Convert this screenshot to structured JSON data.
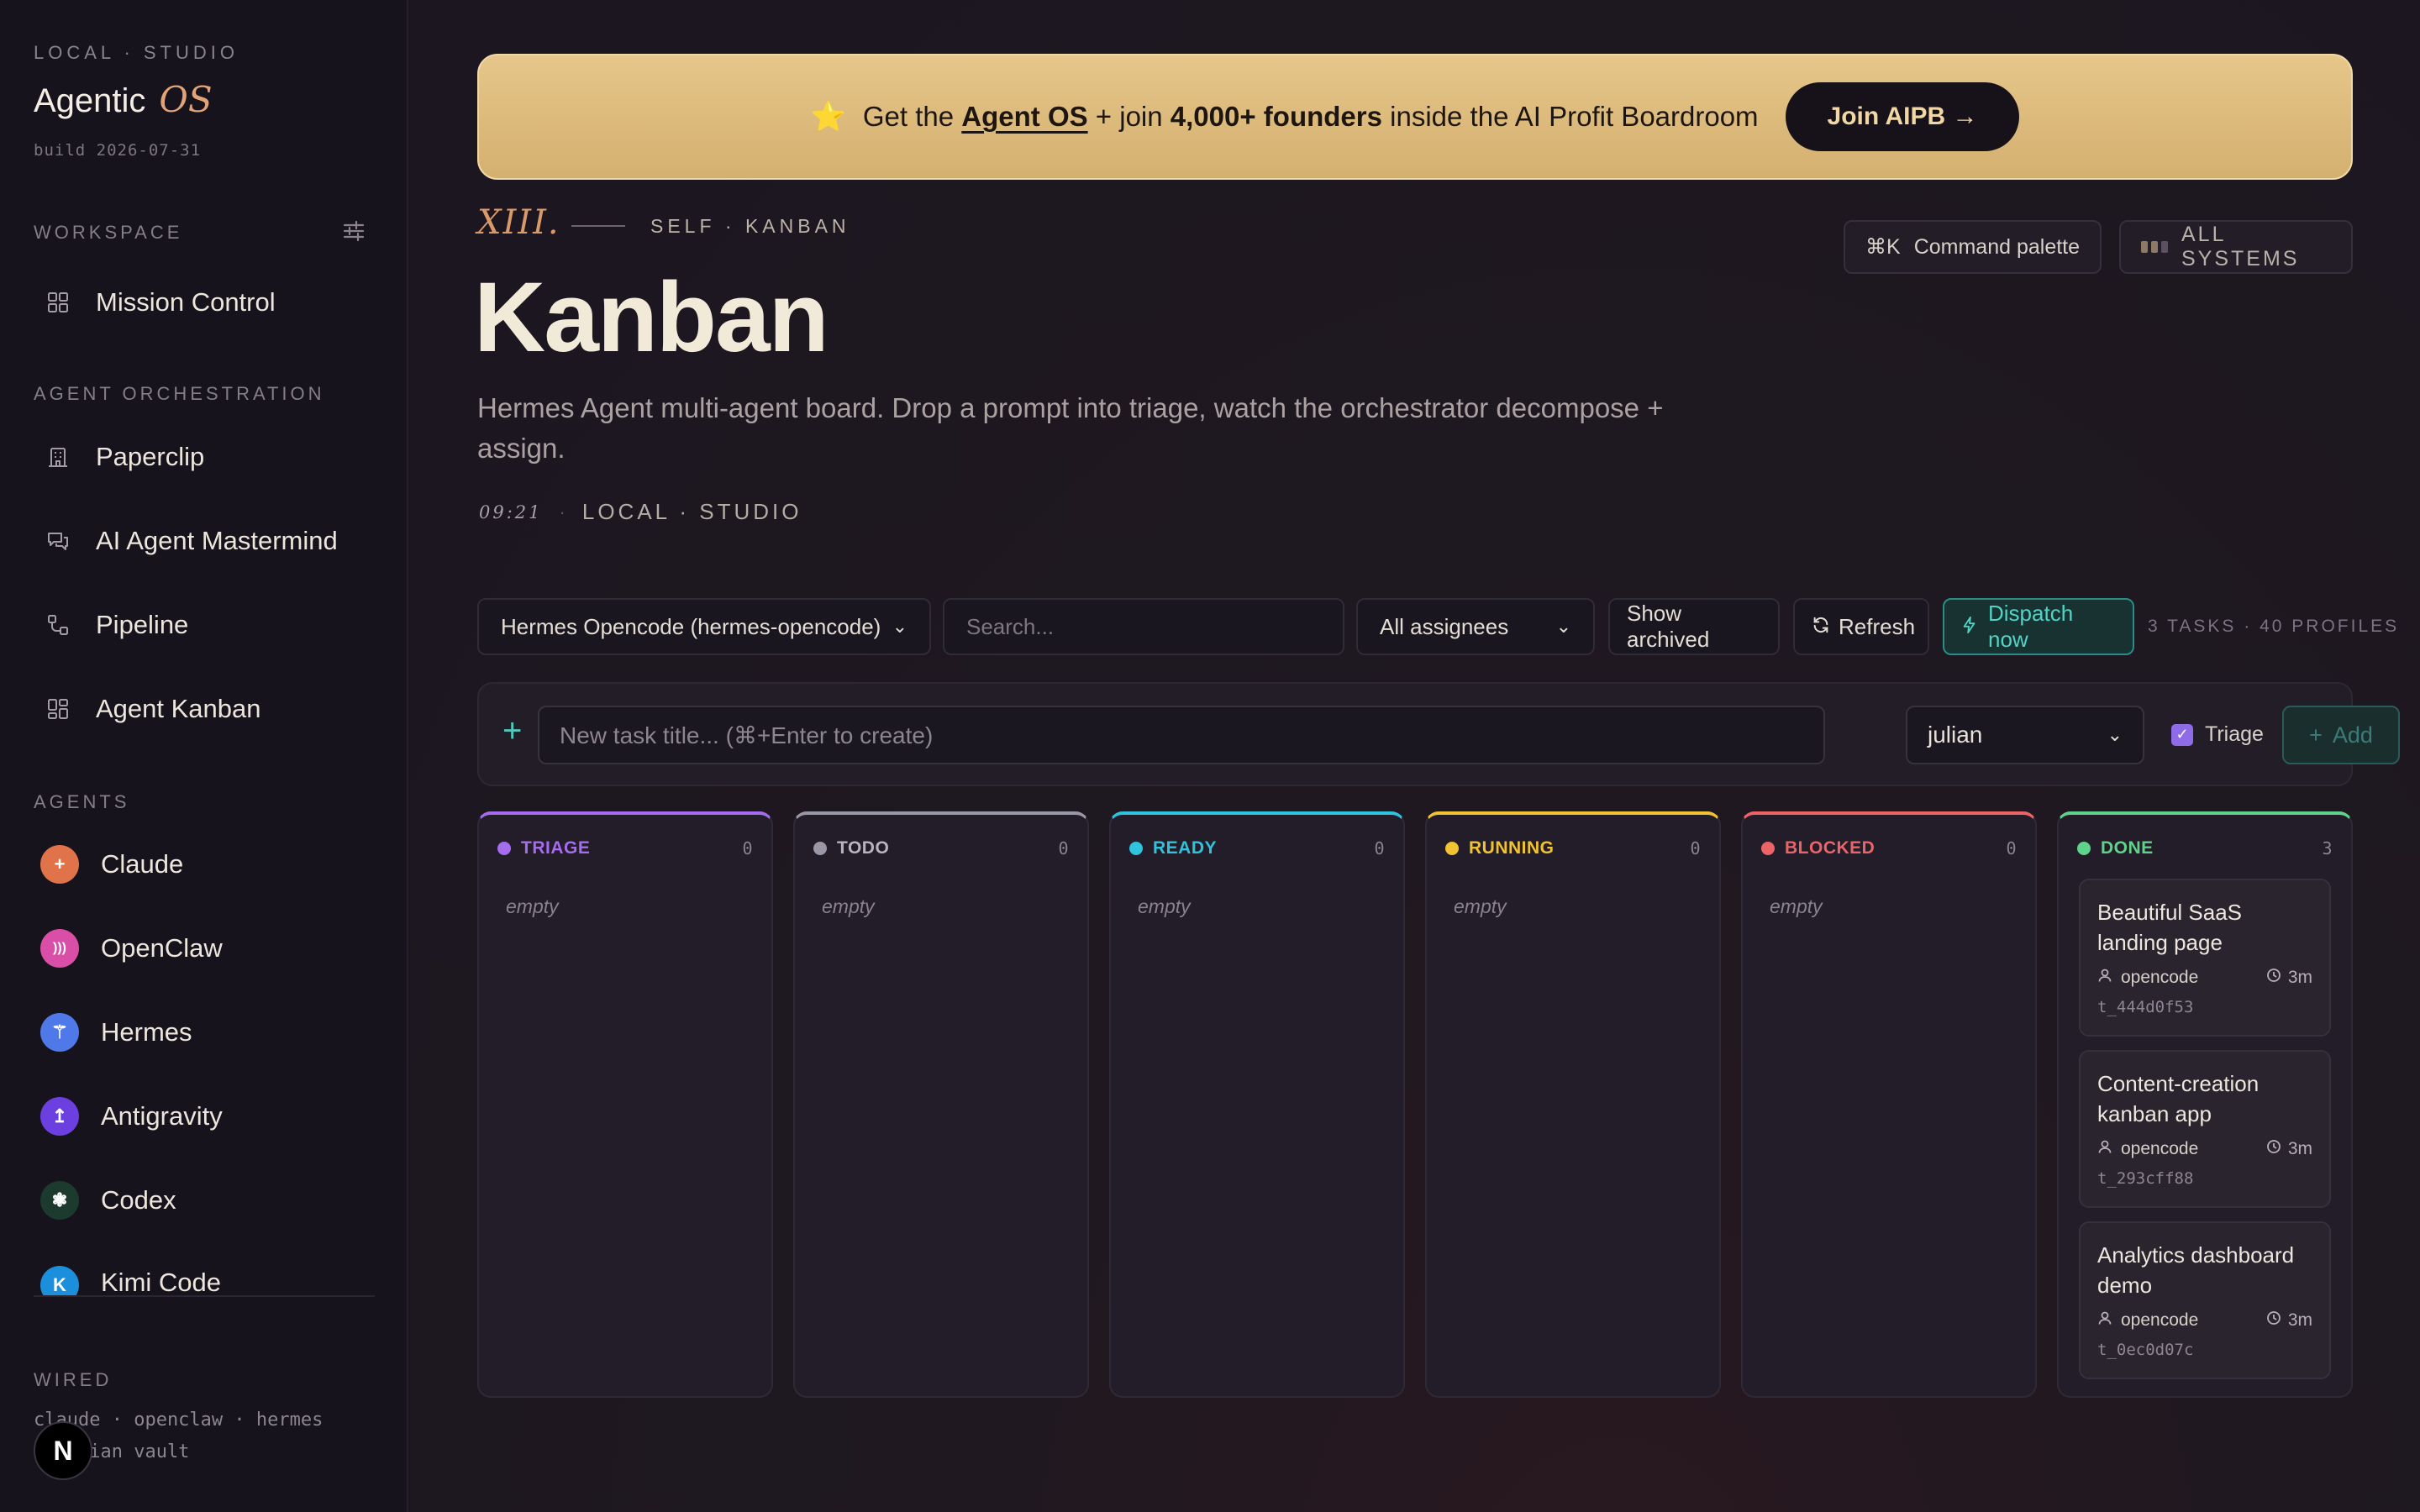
{
  "sidebar": {
    "eyebrow": "LOCAL · STUDIO",
    "brand": "Agentic",
    "brand_accent": "OS",
    "build": "build 2026-07-31",
    "workspace_label": "WORKSPACE",
    "workspace_items": [
      {
        "label": "Mission Control",
        "icon": "grid-icon"
      }
    ],
    "orchestration_label": "AGENT ORCHESTRATION",
    "orchestration_items": [
      {
        "label": "Paperclip",
        "icon": "building-icon"
      },
      {
        "label": "AI Agent Mastermind",
        "icon": "chat-icon"
      },
      {
        "label": "Pipeline",
        "icon": "pipeline-icon"
      },
      {
        "label": "Agent Kanban",
        "icon": "grid-icon"
      }
    ],
    "agents_label": "AGENTS",
    "agents": [
      {
        "label": "Claude",
        "glyph": "+",
        "color": "#e0734a"
      },
      {
        "label": "OpenClaw",
        "glyph": ")))",
        "color": "#d94fa7"
      },
      {
        "label": "Hermes",
        "glyph": "⚚",
        "color": "#4f78e8"
      },
      {
        "label": "Antigravity",
        "glyph": "↥",
        "color": "#6b3fe0"
      },
      {
        "label": "Codex",
        "glyph": "❃",
        "color": "#1c3a2e"
      },
      {
        "label": "Kimi Code",
        "glyph": "K",
        "color": "#1b8fdc"
      }
    ],
    "wired_label": "WIRED",
    "wired_line1": "claude · openclaw · hermes",
    "wired_line2": "obsidian vault",
    "n_badge": "N"
  },
  "banner": {
    "star": "⭐",
    "text_pre": "Get the ",
    "text_link": "Agent OS",
    "text_mid": " + join ",
    "text_bold": "4,000+ founders",
    "text_post": " inside the AI Profit Boardroom",
    "button": "Join AIPB →"
  },
  "header": {
    "numeral": "XIII.",
    "eyebrow": "SELF · KANBAN",
    "title": "Kanban",
    "description": "Hermes Agent multi-agent board. Drop a prompt into triage, watch the orchestrator decompose + assign.",
    "time": "09:21",
    "location": "LOCAL · STUDIO",
    "command_key": "⌘K",
    "command_label": "Command palette",
    "systems_label": "ALL SYSTEMS"
  },
  "toolbar": {
    "board_select": "Hermes Opencode (hermes-opencode)",
    "search_placeholder": "Search...",
    "assignee_select": "All assignees",
    "show_archived": "Show archived",
    "refresh": "Refresh",
    "dispatch": "Dispatch now",
    "counts": "3 TASKS · 40 PROFILES"
  },
  "quick_add": {
    "plus": "+",
    "placeholder": "New task title... (⌘+Enter to create)",
    "assignee": "julian",
    "triage_label": "Triage",
    "triage_checked": true,
    "add_label": "Add"
  },
  "columns": [
    {
      "name": "TRIAGE",
      "count": "0",
      "color": "#a66cf0",
      "empty": "empty"
    },
    {
      "name": "TODO",
      "count": "0",
      "color": "#9a98a6",
      "empty": "empty"
    },
    {
      "name": "READY",
      "count": "0",
      "color": "#2fc3dd",
      "empty": "empty"
    },
    {
      "name": "RUNNING",
      "count": "0",
      "color": "#f1c232",
      "empty": "empty"
    },
    {
      "name": "BLOCKED",
      "count": "0",
      "color": "#ec6467",
      "empty": "empty"
    },
    {
      "name": "DONE",
      "count": "3",
      "color": "#5fd389",
      "empty": ""
    }
  ],
  "done_cards": [
    {
      "title": "Beautiful SaaS landing page",
      "assignee": "opencode",
      "age": "3m",
      "id": "t_444d0f53"
    },
    {
      "title": "Content-creation kanban app",
      "assignee": "opencode",
      "age": "3m",
      "id": "t_293cff88"
    },
    {
      "title": "Analytics dashboard demo",
      "assignee": "opencode",
      "age": "3m",
      "id": "t_0ec0d07c"
    }
  ]
}
